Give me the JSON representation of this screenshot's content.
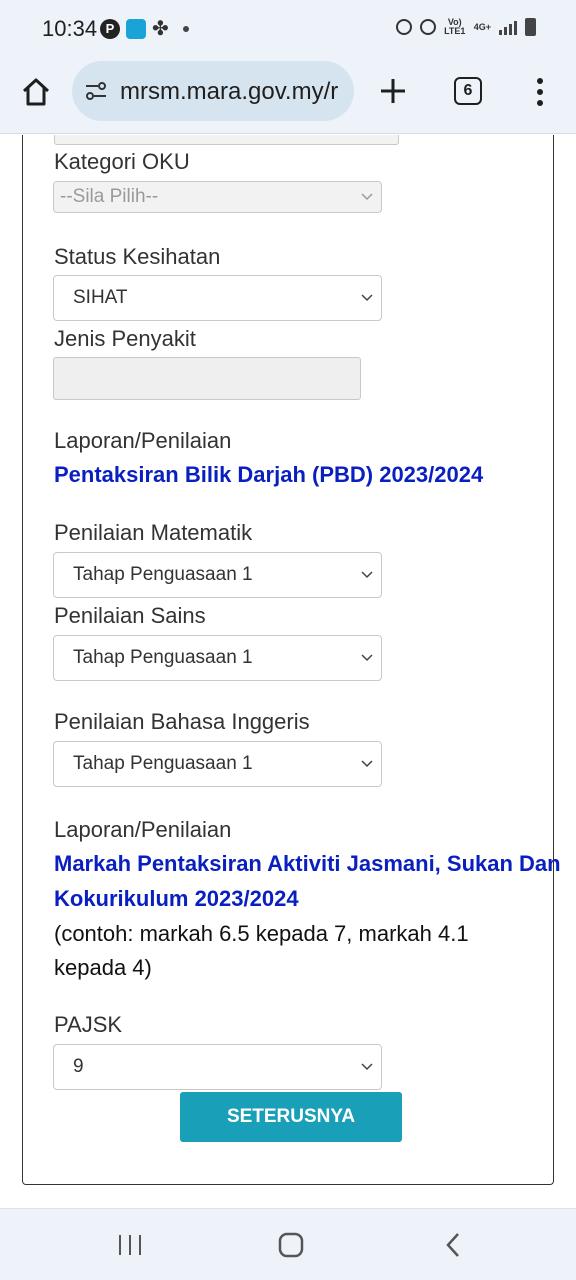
{
  "status_bar": {
    "time": "10:34",
    "volte_label": "Vo) LTE1",
    "network_label": "4G+"
  },
  "browser": {
    "url": "mrsm.mara.gov.my/r",
    "tab_count": "6"
  },
  "form": {
    "kategori_oku": {
      "label": "Kategori OKU",
      "value": "--Sila Pilih--"
    },
    "status_kesihatan": {
      "label": "Status Kesihatan",
      "value": "SIHAT"
    },
    "jenis_penyakit": {
      "label": "Jenis Penyakit",
      "value": ""
    },
    "section_pbd": {
      "label": "Laporan/Penilaian",
      "title": "Pentaksiran Bilik Darjah (PBD) 2023/2024"
    },
    "penilaian_matematik": {
      "label": "Penilaian Matematik",
      "value": "Tahap Penguasaan 1"
    },
    "penilaian_sains": {
      "label": "Penilaian Sains",
      "value": "Tahap Penguasaan 1"
    },
    "penilaian_bahasa_inggeris": {
      "label": "Penilaian Bahasa Inggeris",
      "value": "Tahap Penguasaan 1"
    },
    "section_pajsk": {
      "label": "Laporan/Penilaian",
      "title_line1": "Markah Pentaksiran Aktiviti Jasmani, Sukan Dan",
      "title_line2": "Kokurikulum 2023/2024",
      "note_line1": "(contoh: markah 6.5 kepada 7, markah 4.1",
      "note_line2": "kepada 4)"
    },
    "pajsk": {
      "label": "PAJSK",
      "value": "9"
    },
    "next_button": "SETERUSNYA"
  },
  "icons": {
    "home": "home-icon",
    "site_settings": "tune-icon",
    "new_tab": "plus-icon",
    "tabs": "tab-switcher-icon",
    "menu": "more-vert-icon",
    "nav_recents": "recents-icon",
    "nav_home": "nav-home-icon",
    "nav_back": "back-icon"
  },
  "colors": {
    "section_title": "#0a1fbf",
    "button": "#1a9fb8",
    "chrome_bg": "#eef3f9"
  }
}
